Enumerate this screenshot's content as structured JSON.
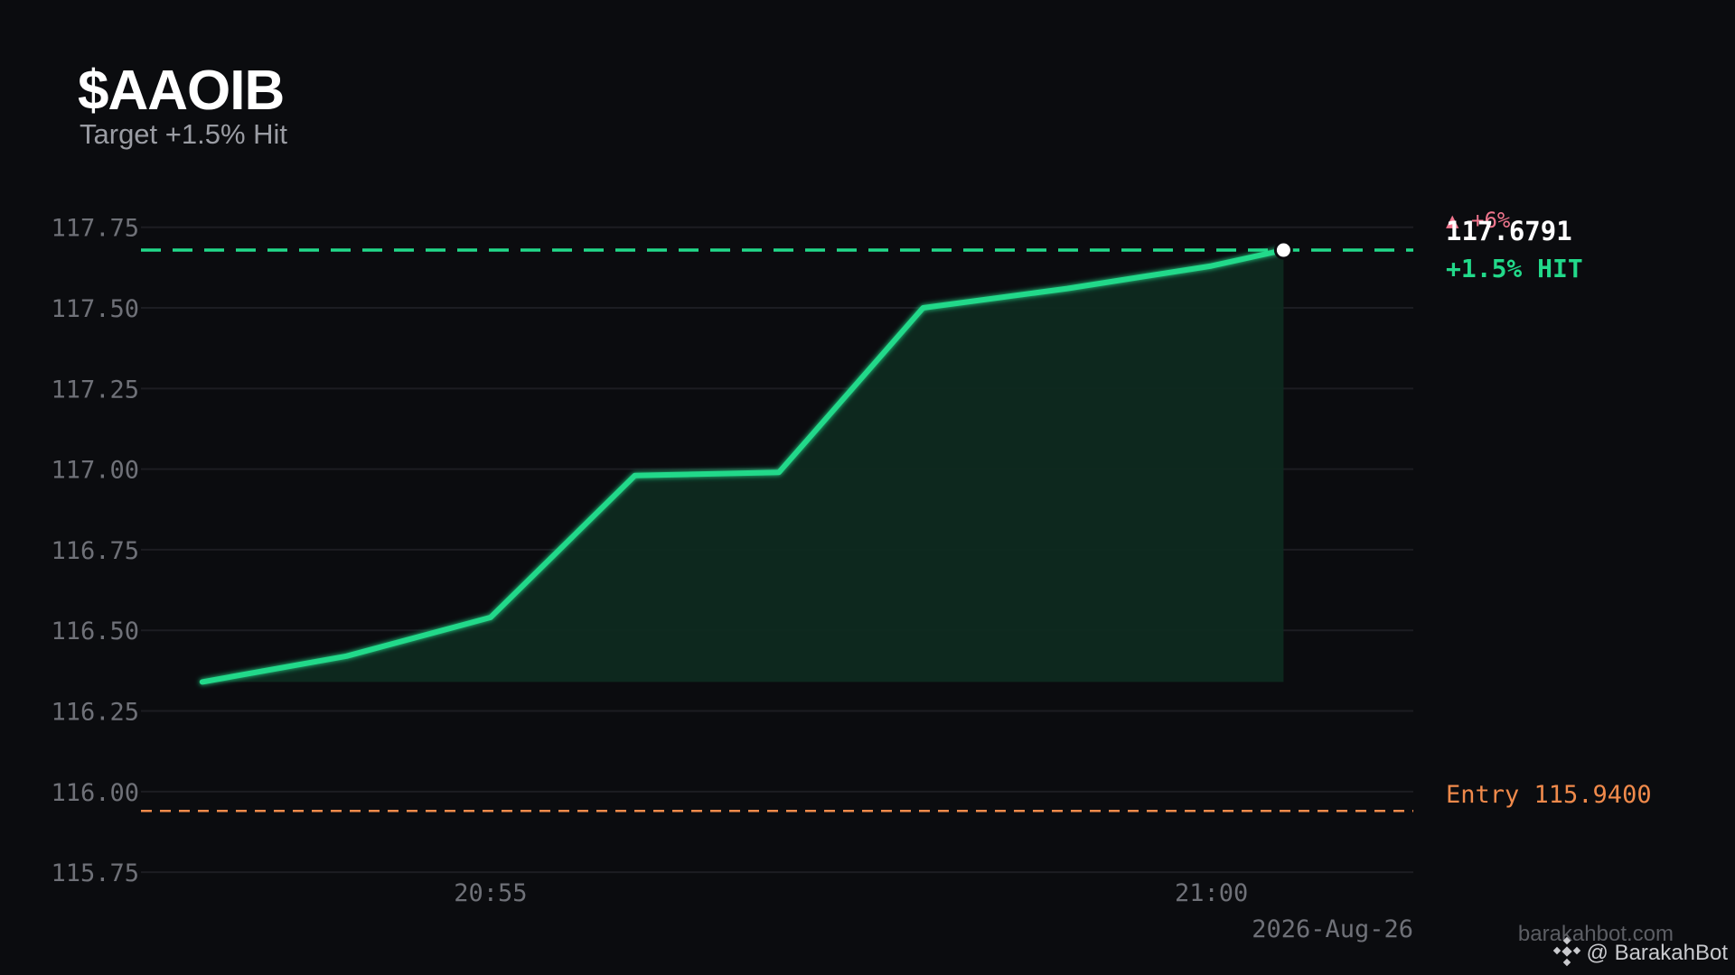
{
  "header": {
    "ticker": "$AAOIB",
    "subtitle": "Target +1.5% Hit"
  },
  "labels": {
    "change": "+6%",
    "current_price": "117.6791",
    "target_text": "+1.5%  HIT",
    "entry_text": "Entry 115.9400",
    "date": "2026-Aug-26"
  },
  "watermark": {
    "site": "barakahbot.com",
    "handle": "@ BarakahBot",
    "icon": "binance-diamond-icon"
  },
  "colors": {
    "background": "#0b0c0f",
    "line": "#22d98a",
    "area_fill": "#0e2a20",
    "target": "#22d98a",
    "entry": "#f08a4b",
    "change": "#f0768e",
    "grid": "#1c1d22"
  },
  "chart_data": {
    "type": "line",
    "x": [
      "20:53",
      "20:54",
      "20:55",
      "20:56",
      "20:57",
      "20:58",
      "20:59",
      "21:00",
      "21:00:30"
    ],
    "x_minutes": [
      0,
      1,
      2,
      3,
      4,
      5,
      6,
      7,
      7.5
    ],
    "values": [
      116.34,
      116.42,
      116.54,
      116.98,
      116.99,
      117.5,
      117.56,
      117.63,
      117.6791
    ],
    "ylim": [
      115.7,
      117.85
    ],
    "yticks": [
      "115.75",
      "116.00",
      "116.25",
      "116.50",
      "116.75",
      "117.00",
      "117.25",
      "117.50",
      "117.75"
    ],
    "ytick_values": [
      115.75,
      116.0,
      116.25,
      116.5,
      116.75,
      117.0,
      117.25,
      117.5,
      117.75
    ],
    "xticks": [
      {
        "label": "20:55",
        "minute": 2
      },
      {
        "label": "21:00",
        "minute": 7
      }
    ],
    "xlim_minutes": [
      -0.4,
      8.4
    ],
    "target_price": 117.6791,
    "entry_price": 115.94,
    "grid": true,
    "legend": "none"
  }
}
